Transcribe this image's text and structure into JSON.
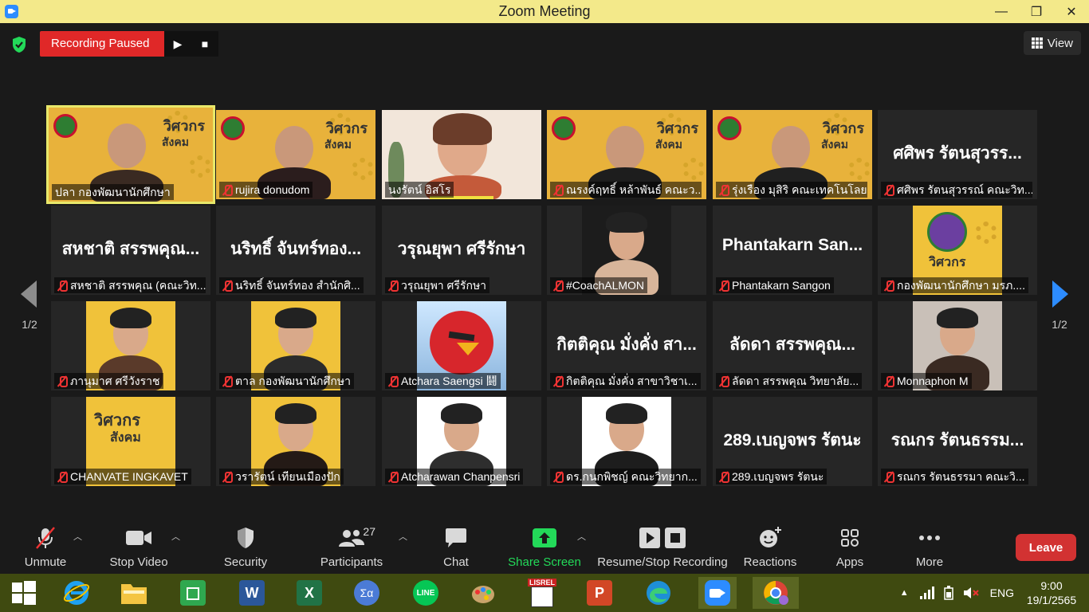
{
  "window": {
    "title": "Zoom Meeting",
    "minimize": "—",
    "maximize": "❐",
    "close": "✕"
  },
  "recording": {
    "status": "Recording Paused",
    "resume": "▶",
    "stop": "■"
  },
  "view": {
    "label": "View"
  },
  "pagination": {
    "left": "1/2",
    "right": "1/2"
  },
  "participants": [
    {
      "label": "ปลา กองพัฒนานักศึกษา",
      "muted": false,
      "big": "",
      "active": true
    },
    {
      "label": "rujira donudom",
      "muted": true,
      "big": ""
    },
    {
      "label": "นงรัตน์ อิสโร",
      "muted": false,
      "big": ""
    },
    {
      "label": "ณรงค์ฤทธิ์ หล้าพันธ์ คณะว...",
      "muted": true,
      "big": ""
    },
    {
      "label": "รุ่งเรือง มุสิริ คณะเทคโนโลย...",
      "muted": true,
      "big": ""
    },
    {
      "label": "ศศิพร รัตนสุวรรณ์ คณะวิท...",
      "muted": true,
      "big": "ศศิพร รัตนสุวรร..."
    },
    {
      "label": "สหชาติ สรรพคุณ (คณะวิท...",
      "muted": true,
      "big": "สหชาติ สรรพคุณ..."
    },
    {
      "label": "นริทธิ์ จันทร์ทอง สำนักศิ...",
      "muted": true,
      "big": "นริทธิ์ จันทร์ทอง..."
    },
    {
      "label": "วรุณยุพา ศรีรักษา",
      "muted": true,
      "big": "วรุณยุพา ศรีรักษา"
    },
    {
      "label": "#CoachALMON",
      "muted": true,
      "big": ""
    },
    {
      "label": "Phantakarn Sangon",
      "muted": true,
      "big": "Phantakarn San..."
    },
    {
      "label": "กองพัฒนานักศึกษา มรภ....",
      "muted": true,
      "big": ""
    },
    {
      "label": "ภานุมาศ ศรีวังราช",
      "muted": true,
      "big": ""
    },
    {
      "label": "ตาล กองพัฒนานักศึกษา",
      "muted": true,
      "big": ""
    },
    {
      "label": "Atchara Saengsi 鬪",
      "muted": true,
      "big": ""
    },
    {
      "label": "กิตติคุณ มั่งคั่ง สาขาวิชาเ...",
      "muted": true,
      "big": "กิตติคุณ มั่งคั่ง สา..."
    },
    {
      "label": "ลัดดา สรรพคุณ วิทยาลัย...",
      "muted": true,
      "big": "ลัดดา สรรพคุณ..."
    },
    {
      "label": "Monnaphon M",
      "muted": true,
      "big": ""
    },
    {
      "label": "CHANVATE INGKAVET",
      "muted": true,
      "big": ""
    },
    {
      "label": "วรารัตน์ เทียนเมืองปัก",
      "muted": true,
      "big": ""
    },
    {
      "label": "Atcharawan Chanpensri",
      "muted": true,
      "big": ""
    },
    {
      "label": "ดร.กนกพิชญ์ คณะวิทยาก...",
      "muted": true,
      "big": ""
    },
    {
      "label": "289.เบญจพร รัตนะ",
      "muted": true,
      "big": "289.เบญจพร รัตนะ"
    },
    {
      "label": "รณกร รัตนธรรมา คณะวิ...",
      "muted": true,
      "big": "รณกร รัตนธรรม..."
    }
  ],
  "poster": {
    "line1": "วิศวกร",
    "line2": "สังคม"
  },
  "toolbar": {
    "unmute": "Unmute",
    "stop_video": "Stop Video",
    "security": "Security",
    "participants": "Participants",
    "participants_count": "27",
    "chat": "Chat",
    "share_screen": "Share Screen",
    "recording": "Resume/Stop Recording",
    "reactions": "Reactions",
    "apps": "Apps",
    "more": "More",
    "leave": "Leave"
  },
  "taskbar": {
    "lang": "ENG",
    "time": "9:00",
    "date": "19/1/2565",
    "lisrel": "LISREL"
  },
  "colors": {
    "accent_green": "#23d959",
    "record_red": "#e02828",
    "leave_red": "#d23232",
    "titlebar": "#f3e98a",
    "taskbar": "#3f4a10"
  }
}
